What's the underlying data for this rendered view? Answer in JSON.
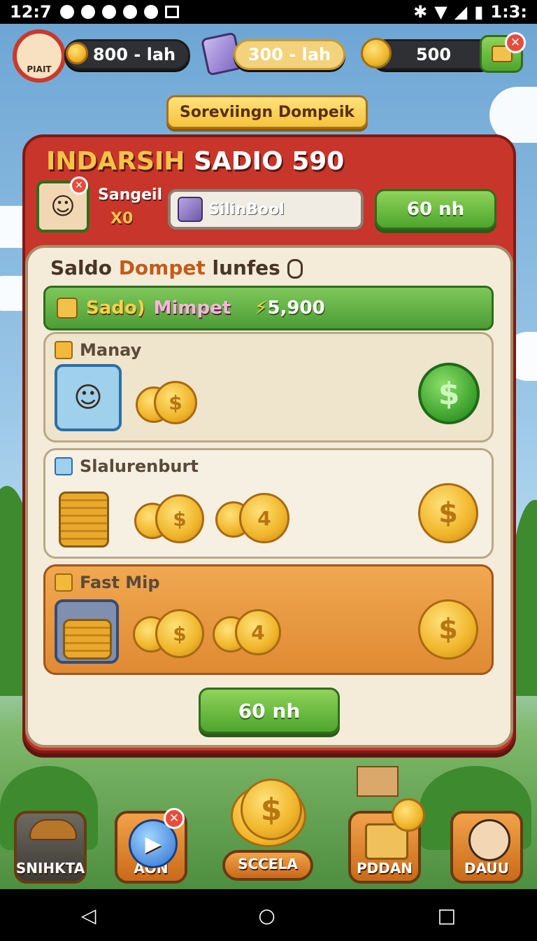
{
  "status_bar": {
    "time_left": "12:7",
    "time_right": "1:3:"
  },
  "top_bar": {
    "player_badge": "PIAIT",
    "coins_left": "800 - lah",
    "coins_middle": "300 - lah",
    "coins_right": "500"
  },
  "title_banner": "Soreviingn Dompeik",
  "panel": {
    "title_gold": "INDARSIH",
    "title_white": "SADIO 590",
    "player_name": "Sangeil",
    "multiplier": "X0",
    "search_value": "SilinBool",
    "action_button": "60 nh"
  },
  "inner": {
    "title_a": "Saldo",
    "title_b": "Dompet",
    "title_c": "lunfes",
    "balance_label_a": "Sado)",
    "balance_label_b": "Mimpet",
    "balance_value": "5,900"
  },
  "cards": [
    {
      "title": "Manay"
    },
    {
      "title": "Slalurenburt"
    },
    {
      "title": "Fast Mip"
    }
  ],
  "coin_glyph": "$",
  "coin_alt_glyph": "4",
  "confirm_button": "60 nh",
  "bottom_nav": [
    {
      "label": "SNIHKTA"
    },
    {
      "label": "AON"
    },
    {
      "label": "SCCELA"
    },
    {
      "label": "PDDAN"
    },
    {
      "label": "DAUU"
    }
  ],
  "android_nav": {
    "back": "◁",
    "home": "○",
    "recents": "□"
  }
}
